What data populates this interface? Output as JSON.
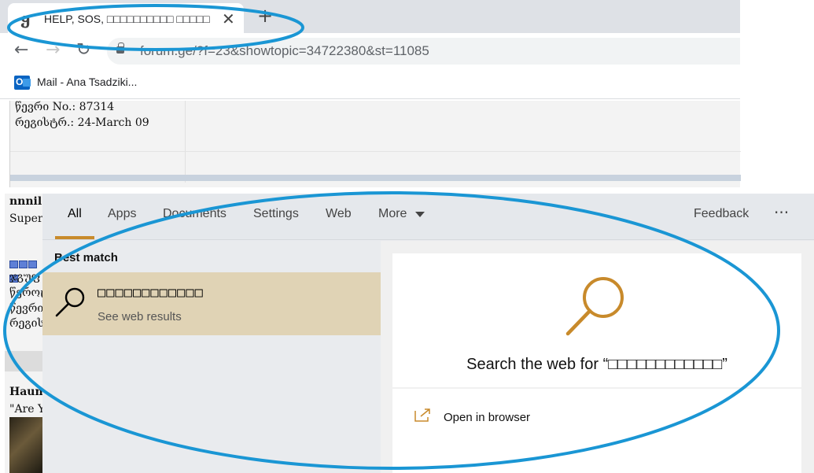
{
  "browser": {
    "tab": {
      "favicon": "ყ",
      "title": "HELP, SOS, □□□□□□□□□□ □□□□□",
      "close_icon": "close-icon",
      "close_glyph": "✕"
    },
    "new_tab_glyph": "+",
    "nav": {
      "back_glyph": "←",
      "forward_glyph": "→",
      "reload_glyph": "↻"
    },
    "url": "forum.ge/?f=23&showtopic=34722380&st=11085",
    "bookmark": {
      "icon": "outlook-icon",
      "icon_letter": "O",
      "label": "Mail - Ana Tsadziki..."
    }
  },
  "forum": {
    "post_no": "წევრი No.: 87314",
    "registered": "რეგისტრ.: 24-March 09",
    "left_user_name": "nnnil",
    "left_rank": "Super",
    "left_lines": [
      "ჯგუფ",
      "წეროც",
      "წევრი",
      "რეგის"
    ],
    "left_user_name2": "Haun",
    "left_quote": "\"Are Y"
  },
  "search": {
    "tabs": [
      {
        "label": "All",
        "active": true
      },
      {
        "label": "Apps"
      },
      {
        "label": "Documents"
      },
      {
        "label": "Settings"
      },
      {
        "label": "Web"
      },
      {
        "label": "More"
      }
    ],
    "feedback": "Feedback",
    "ellipsis": "···",
    "best_match_label": "Best match",
    "result": {
      "title": "□□□□□□□□□□□□",
      "subtitle": "See web results",
      "icon": "search-icon"
    },
    "preview": {
      "title": "Search the web for “□□□□□□□□□□□□”",
      "icon": "search-icon",
      "accent": "#c88a2b"
    },
    "open_in_browser": "Open in browser",
    "open_icon": "open-external-icon"
  },
  "colors": {
    "highlight": "#e0d3b5",
    "accent": "#c88a2b",
    "annotation": "#1a96d4"
  }
}
